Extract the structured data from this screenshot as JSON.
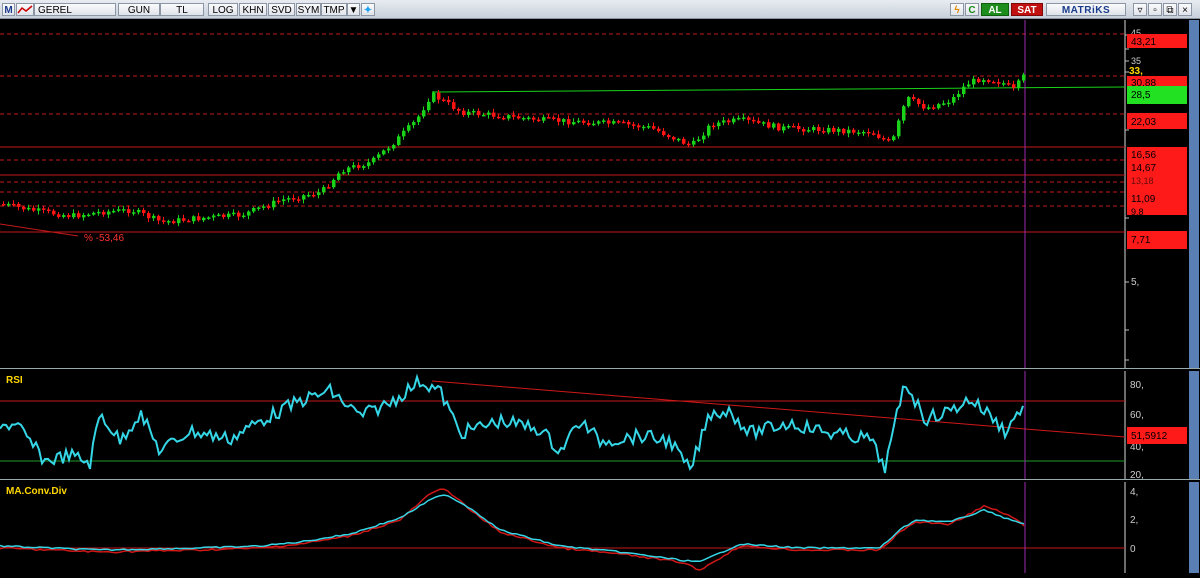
{
  "toolbar": {
    "logo": "M",
    "buttons": [
      "GEREL",
      "GUN",
      "TL",
      "LOG",
      "KHN",
      "SVD",
      "SYM",
      "TMP"
    ],
    "right": {
      "buy": "AL",
      "sell": "SAT",
      "brand": "MATRiKS"
    }
  },
  "colors": {
    "bull": "#19d219",
    "bear": "#ff1414",
    "axis_bg_red": "#ff1a1a",
    "axis_bg_green": "#22e022",
    "rsi": "#35d6e6",
    "macd_signal": "#d01818"
  },
  "price_pane": {
    "scale_labels": [
      "45,",
      "35",
      "33,",
      "5,"
    ],
    "level_labels": [
      "43,21",
      "30,88",
      "28,5",
      "22,03",
      "16,56",
      "14,67",
      "13,18",
      "11,09",
      "9,8",
      "7,71"
    ],
    "current_value": "33,",
    "trendline_label": "% -53,46"
  },
  "rsi_pane": {
    "title": "RSI",
    "scale_labels": [
      "80,",
      "60,",
      "40,",
      "20,"
    ],
    "value_tag": "51,5912"
  },
  "macd_pane": {
    "title": "MA.Conv.Div",
    "scale_labels": [
      "4,",
      "2,",
      "0"
    ]
  }
}
